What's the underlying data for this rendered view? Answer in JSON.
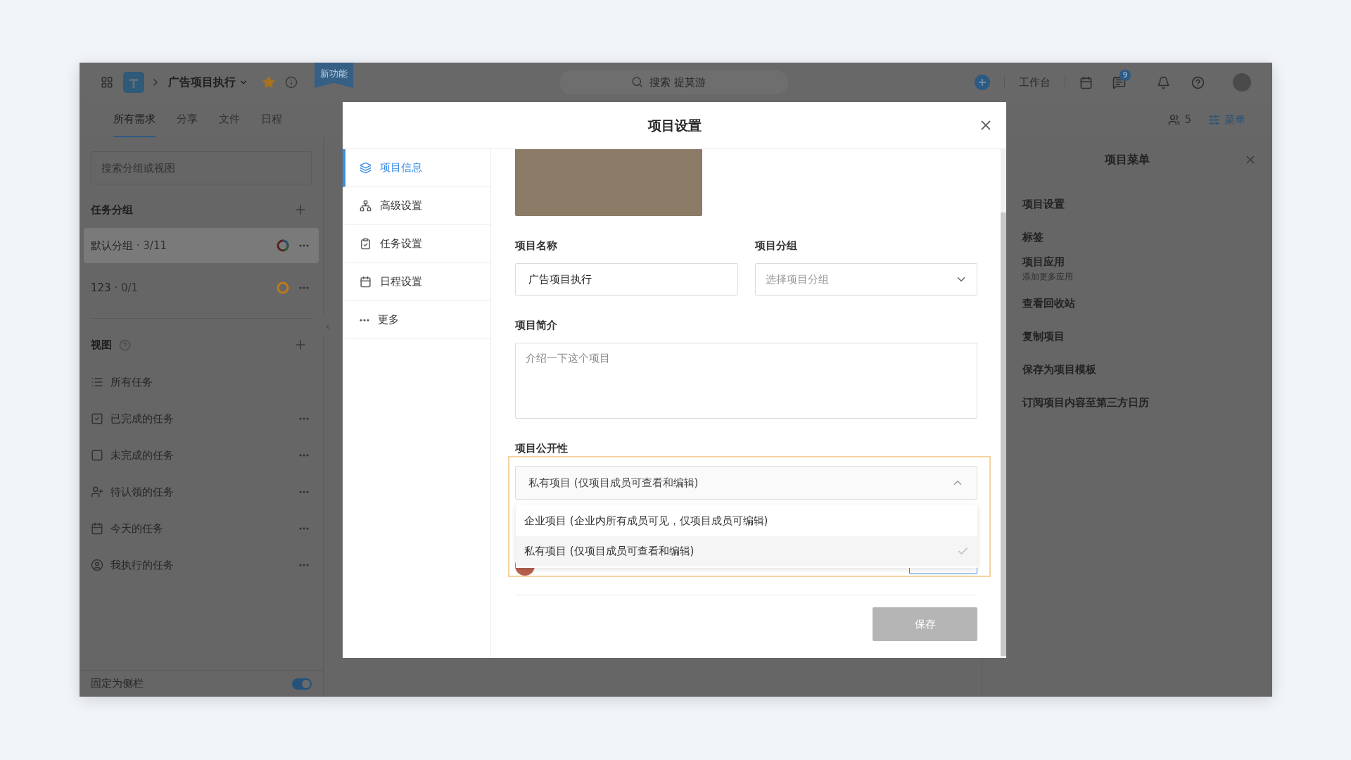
{
  "topbar": {
    "project": "广告项目执行",
    "starred": true,
    "badge": "新功能",
    "search": {
      "placeholder": "搜索 提莫游"
    },
    "workbench": "工作台",
    "message_count": "9"
  },
  "tabs": [
    {
      "label": "所有需求",
      "selected": true
    },
    {
      "label": "分享",
      "selected": false
    },
    {
      "label": "文件",
      "selected": false
    },
    {
      "label": "日程",
      "selected": false
    }
  ],
  "members_count": "5",
  "menu_button": "菜单",
  "sidebar": {
    "search": {
      "placeholder": "搜索分组或视图"
    },
    "groups_title": "任务分组",
    "groups": [
      {
        "name": "默认分组",
        "count": "· 3/11",
        "selected": true,
        "kind": "multicolor"
      },
      {
        "name": "123",
        "count": "· 0/1",
        "selected": false,
        "kind": "solid",
        "color": "#c07a1a"
      }
    ],
    "views_title": "视图",
    "views": [
      {
        "label": "所有任务",
        "kind": "list",
        "has_more": false
      },
      {
        "label": "已完成的任务",
        "kind": "done",
        "has_more": true
      },
      {
        "label": "未完成的任务",
        "kind": "todo",
        "has_more": true
      },
      {
        "label": "待认领的任务",
        "kind": "claim",
        "has_more": true
      },
      {
        "label": "今天的任务",
        "kind": "today",
        "has_more": true
      },
      {
        "label": "我执行的任务",
        "kind": "mine",
        "has_more": true
      }
    ],
    "pin": {
      "label": "固定为侧栏",
      "on": true
    }
  },
  "right_panel": {
    "title": "项目菜单",
    "items": [
      {
        "label": "项目设置"
      },
      {
        "label": "标签"
      },
      {
        "label": "项目应用",
        "sublabel": "添加更多应用"
      },
      {
        "label": "查看回收站"
      },
      {
        "label": "复制项目"
      },
      {
        "label": "保存为项目模板"
      },
      {
        "label": "订阅项目内容至第三方日历"
      }
    ]
  },
  "modal": {
    "title": "项目设置",
    "nav": [
      {
        "label": "项目信息",
        "kind": "info",
        "selected": true
      },
      {
        "label": "高级设置",
        "kind": "advanced",
        "selected": false
      },
      {
        "label": "任务设置",
        "kind": "task",
        "selected": false
      },
      {
        "label": "日程设置",
        "kind": "schedule",
        "selected": false
      },
      {
        "label": "更多",
        "kind": "more",
        "selected": false
      }
    ],
    "name": {
      "label": "项目名称",
      "value": "广告项目执行"
    },
    "group": {
      "label": "项目分组",
      "placeholder": "选择项目分组"
    },
    "description": {
      "label": "项目简介",
      "placeholder": "介绍一下这个项目"
    },
    "visibility": {
      "label": "项目公开性",
      "value": "私有项目 (仅项目成员可查看和编辑)",
      "expanded": true,
      "options": [
        {
          "label": "企业项目 (企业内所有成员可见，仅项目成员可编辑)",
          "selected": false
        },
        {
          "label": "私有项目 (仅项目成员可查看和编辑)",
          "selected": true
        }
      ]
    },
    "save": {
      "label": "保存",
      "disabled": true
    }
  }
}
